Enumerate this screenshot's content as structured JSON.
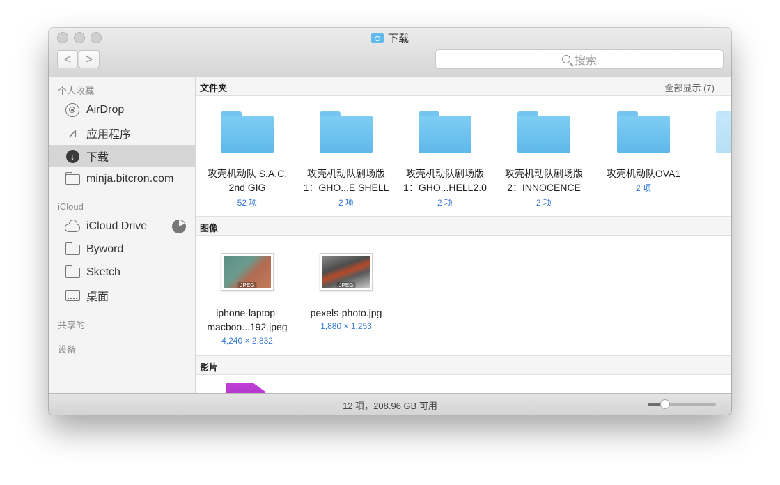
{
  "window": {
    "title": "下载",
    "title_icon": "downloads-folder-icon"
  },
  "toolbar": {
    "back_label": "<",
    "forward_label": ">",
    "search_placeholder": "搜索"
  },
  "sidebar": {
    "favorites_header": "个人收藏",
    "favorites": [
      {
        "label": "AirDrop",
        "icon": "airdrop-icon"
      },
      {
        "label": "应用程序",
        "icon": "applications-icon"
      },
      {
        "label": "下载",
        "icon": "downloads-icon",
        "selected": true
      },
      {
        "label": "minja.bitcron.com",
        "icon": "folder-icon"
      }
    ],
    "icloud_header": "iCloud",
    "icloud": [
      {
        "label": "iCloud Drive",
        "icon": "cloud-icon",
        "storage_used_fraction": 0.82
      },
      {
        "label": "Byword",
        "icon": "folder-icon"
      },
      {
        "label": "Sketch",
        "icon": "folder-icon"
      },
      {
        "label": "桌面",
        "icon": "desktop-icon"
      }
    ],
    "shared_header": "共享的",
    "devices_header": "设备"
  },
  "sections": {
    "folders": {
      "title": "文件夹",
      "show_all": "全部显示 (7)",
      "items": [
        {
          "name_line1": "攻壳机动队 S.A.C.",
          "name_line2": "2nd GIG",
          "sub": "52 项"
        },
        {
          "name_line1": "攻壳机动队剧场版",
          "name_line2": "1：GHO...E SHELL",
          "sub": "2 项"
        },
        {
          "name_line1": "攻壳机动队剧场版",
          "name_line2": "1：GHO...HELL2.0",
          "sub": "2 项"
        },
        {
          "name_line1": "攻壳机动队剧场版",
          "name_line2": "2：INNOCENCE",
          "sub": "2 项"
        },
        {
          "name_line1": "攻壳机动队OVA1",
          "name_line2": "",
          "sub": "2 项"
        }
      ]
    },
    "images": {
      "title": "图像",
      "items": [
        {
          "name_line1": "iphone-laptop-",
          "name_line2": "macboo...192.jpeg",
          "sub": "4,240 × 2,832",
          "tag": "JPEG"
        },
        {
          "name_line1": "pexels-photo.jpg",
          "name_line2": "",
          "sub": "1,880 × 1,253",
          "tag": "JPEG"
        }
      ]
    },
    "movies": {
      "title": "影片"
    }
  },
  "status": {
    "text": "12 项，208.96 GB 可用",
    "zoom_fraction": 0.26
  },
  "colors": {
    "folder_blue": "#6cc3f0",
    "link_blue": "#3a7bd5",
    "selection_gray": "#d5d5d5"
  }
}
